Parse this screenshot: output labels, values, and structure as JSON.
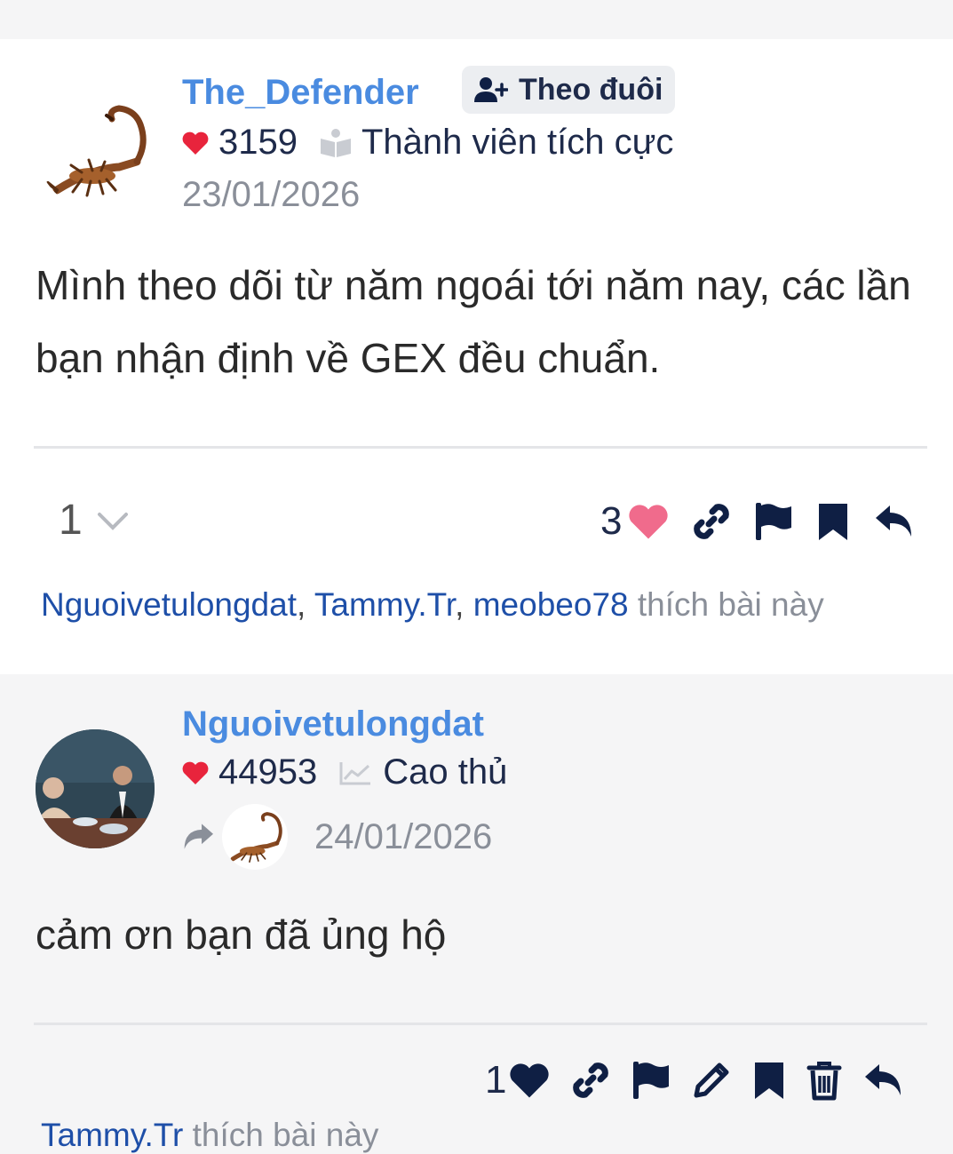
{
  "posts": [
    {
      "username": "The_Defender",
      "follow_label": "Theo đuôi",
      "likes_score": "3159",
      "rank": "Thành viên tích cực",
      "date": "23/01/2026",
      "body": "Mình theo dõi từ năm ngoái tới năm nay, các lần bạn nhận định về GEX đều chuẩn.",
      "reaction_number": "1",
      "like_count": "3",
      "liked_by": [
        "Nguoivetulongdat",
        "Tammy.Tr",
        "meobeo78"
      ],
      "liked_suffix": "thích bài này"
    },
    {
      "username": "Nguoivetulongdat",
      "likes_score": "44953",
      "rank": "Cao thủ",
      "date": "24/01/2026",
      "body": "cảm ơn bạn đã ủng hộ",
      "like_count": "1",
      "liked_by": [
        "Tammy.Tr"
      ],
      "liked_suffix": "thích bài này"
    }
  ],
  "colors": {
    "username": "#4a8be0",
    "heart_red": "#e8243c",
    "heart_pink": "#f06b8c",
    "icon_navy": "#0f1f44",
    "link_blue": "#1e4fa8"
  }
}
